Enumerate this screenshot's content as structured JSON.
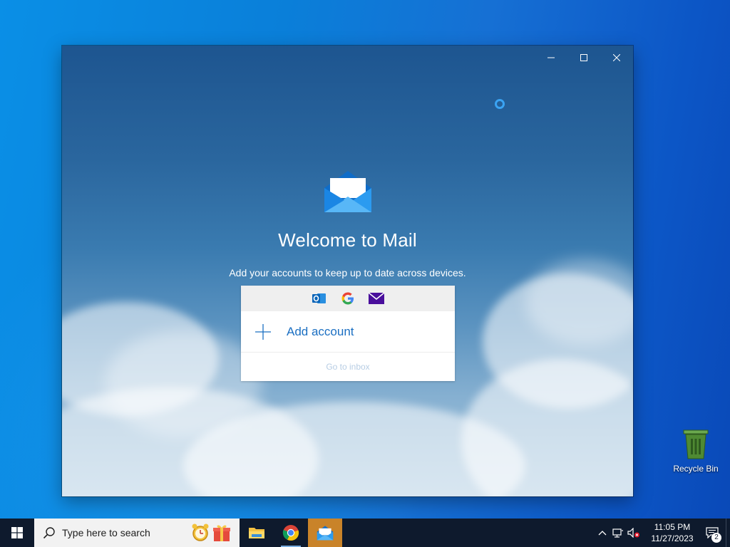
{
  "mail": {
    "welcome_title": "Welcome to Mail",
    "subtitle": "Add your accounts to keep up to date across devices.",
    "providers": [
      "outlook-icon",
      "google-icon",
      "yahoo-mail-icon"
    ],
    "add_account_label": "Add account",
    "go_to_inbox_label": "Go to inbox"
  },
  "window_controls": [
    "minimize",
    "maximize",
    "close"
  ],
  "desktop": {
    "icons": [
      {
        "label": "Recycle Bin",
        "icon": "recycle-bin-icon"
      }
    ]
  },
  "taskbar": {
    "search_placeholder": "Type here to search",
    "apps": [
      {
        "name": "file-explorer-icon",
        "state": "pinned"
      },
      {
        "name": "chrome-icon",
        "state": "running"
      },
      {
        "name": "mail-icon",
        "state": "active"
      }
    ],
    "clock_time": "11:05 PM",
    "clock_date": "11/27/2023",
    "notification_count": "2"
  },
  "colors": {
    "accent": "#1b6fc2",
    "taskbar": "#0e1a2d",
    "active_app": "#c98329"
  }
}
